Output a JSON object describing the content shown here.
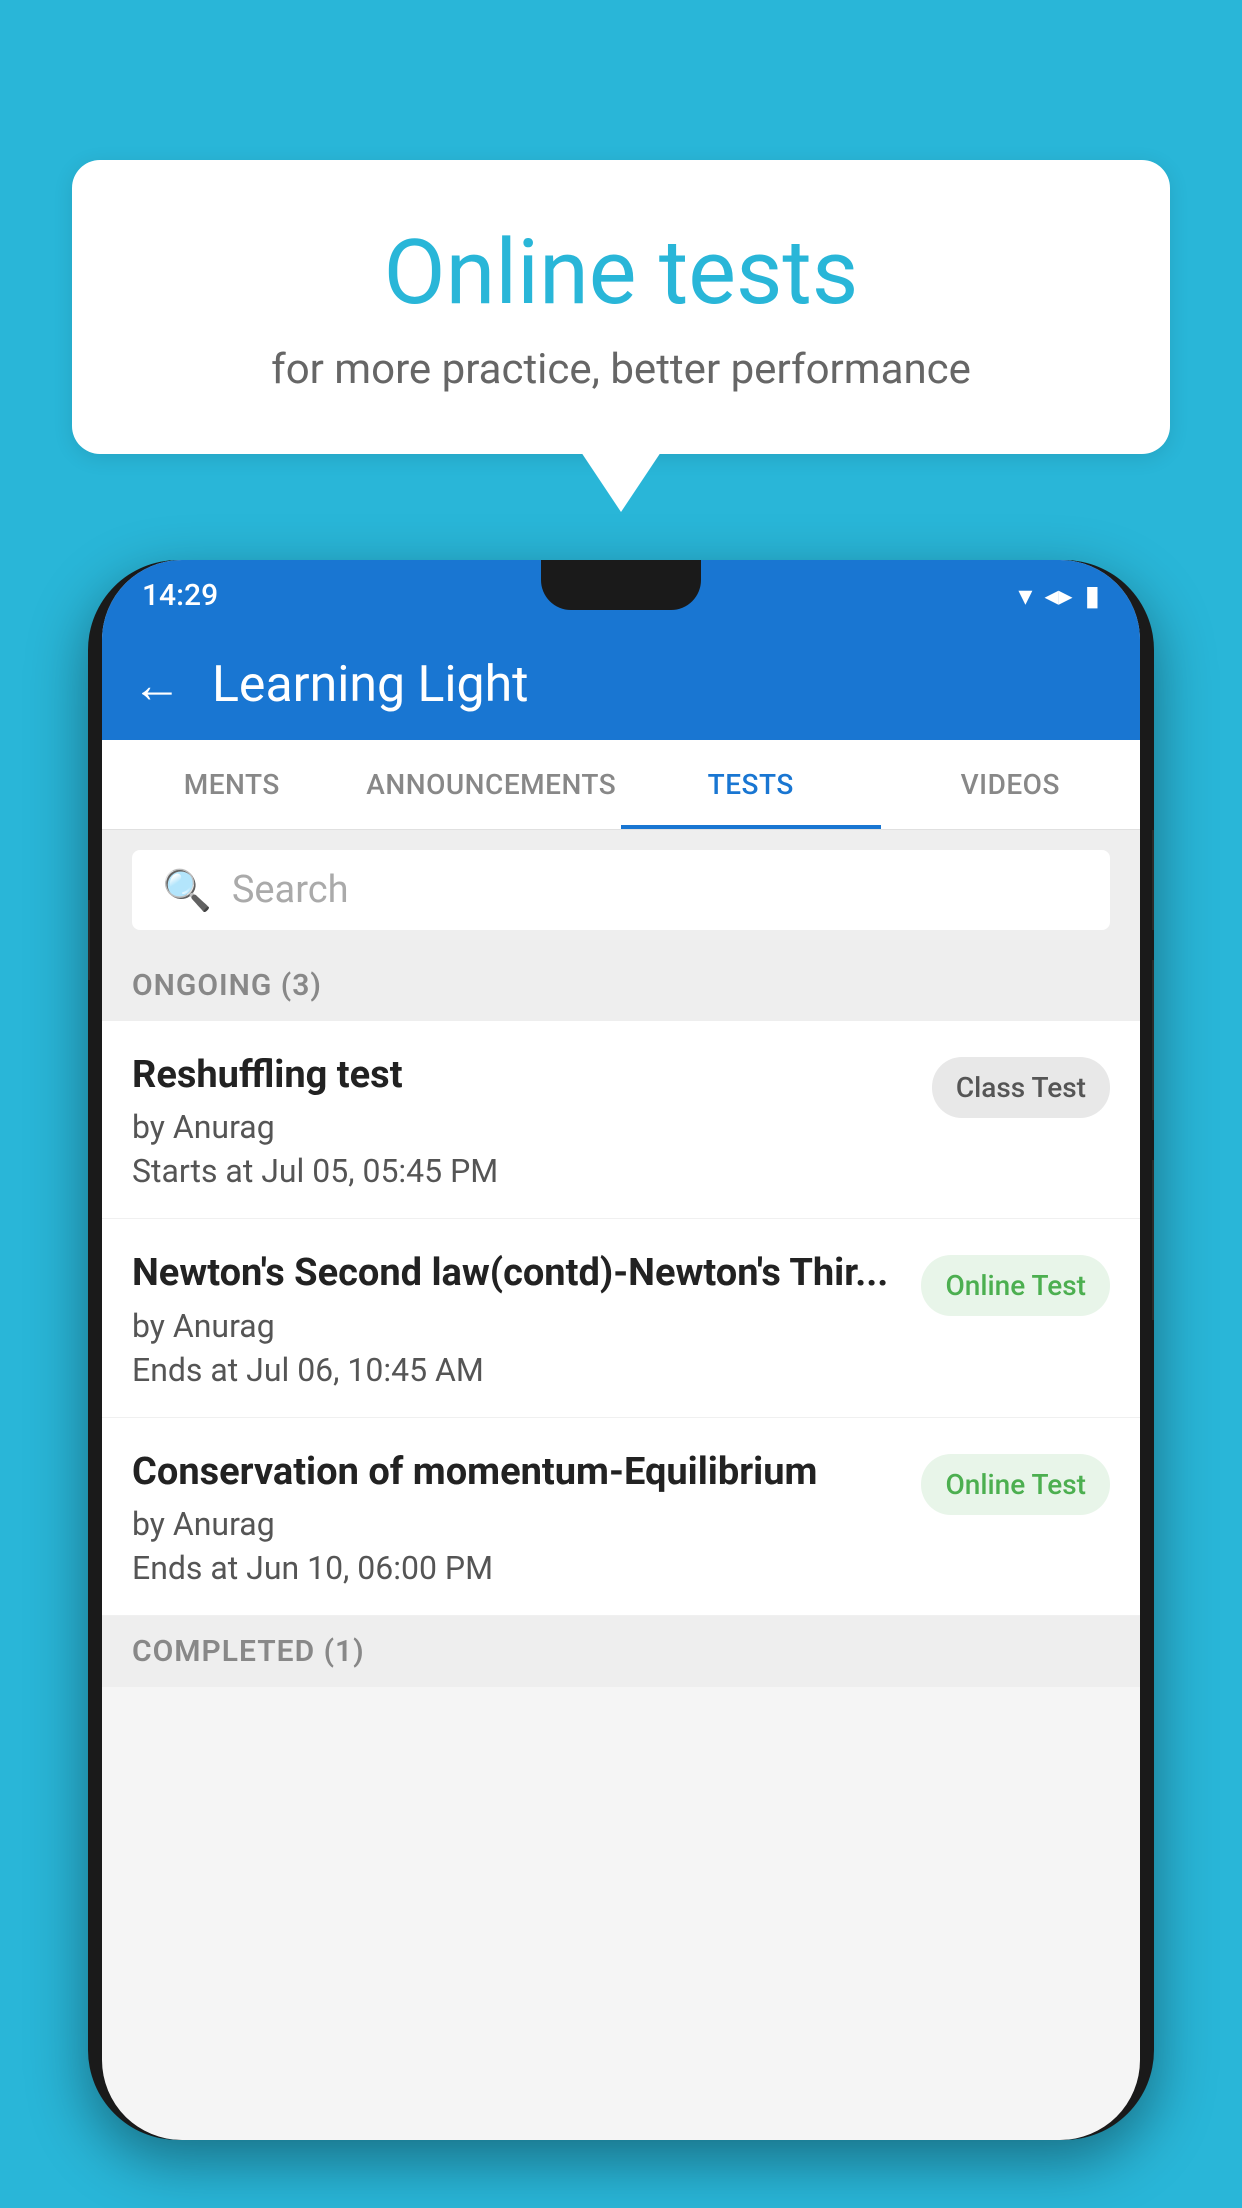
{
  "background": {
    "color": "#29b6d8"
  },
  "speech_bubble": {
    "title": "Online tests",
    "subtitle": "for more practice, better performance"
  },
  "phone": {
    "status_bar": {
      "time": "14:29",
      "wifi_icon": "▼",
      "signal_icon": "▲",
      "battery_icon": "▮"
    },
    "app_bar": {
      "back_icon": "←",
      "title": "Learning Light"
    },
    "tabs": [
      {
        "label": "MENTS",
        "active": false
      },
      {
        "label": "ANNOUNCEMENTS",
        "active": false
      },
      {
        "label": "TESTS",
        "active": true
      },
      {
        "label": "VIDEOS",
        "active": false
      }
    ],
    "search": {
      "placeholder": "Search",
      "icon": "🔍"
    },
    "ongoing_section": {
      "label": "ONGOING (3)"
    },
    "tests": [
      {
        "title": "Reshuffling test",
        "author": "by Anurag",
        "time": "Starts at  Jul 05, 05:45 PM",
        "badge": "Class Test",
        "badge_type": "class"
      },
      {
        "title": "Newton's Second law(contd)-Newton's Thir...",
        "author": "by Anurag",
        "time": "Ends at  Jul 06, 10:45 AM",
        "badge": "Online Test",
        "badge_type": "online"
      },
      {
        "title": "Conservation of momentum-Equilibrium",
        "author": "by Anurag",
        "time": "Ends at  Jun 10, 06:00 PM",
        "badge": "Online Test",
        "badge_type": "online"
      }
    ],
    "completed_section": {
      "label": "COMPLETED (1)"
    }
  }
}
